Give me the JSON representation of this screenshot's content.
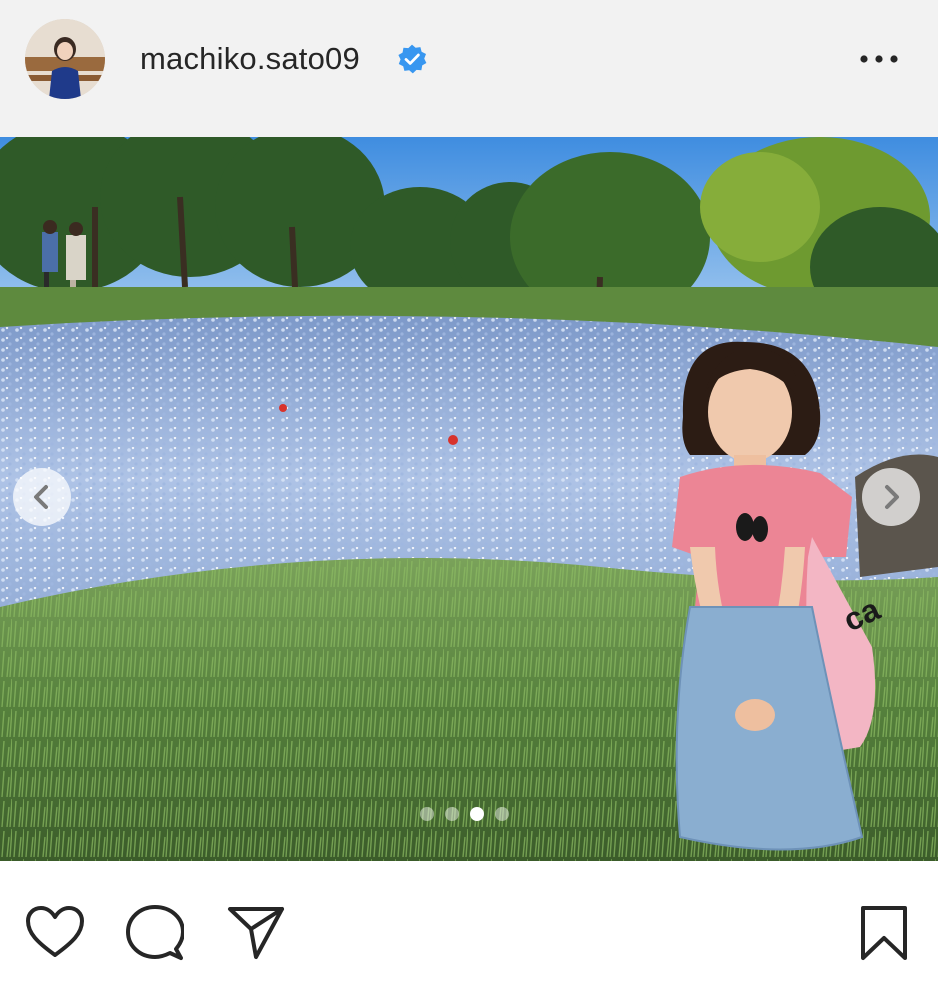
{
  "header": {
    "username": "machiko.sato09",
    "verified_icon": "verified-badge-icon",
    "more_icon": "more-options-icon"
  },
  "carousel": {
    "total_slides": 4,
    "current_slide": 3,
    "prev_icon": "chevron-left-icon",
    "next_icon": "chevron-right-icon"
  },
  "actions": {
    "like_icon": "heart-icon",
    "comment_icon": "comment-icon",
    "share_icon": "send-icon",
    "save_icon": "bookmark-icon"
  },
  "colors": {
    "header_bg": "#f2f2f2",
    "verified_blue": "#3897f0",
    "icon_dark": "#262626"
  }
}
